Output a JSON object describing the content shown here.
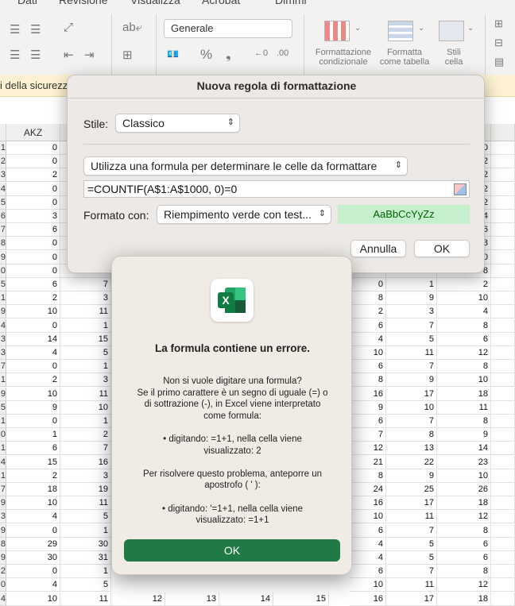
{
  "ribbon": {
    "menu_items": [
      "Dati",
      "Revisione",
      "Visualizza",
      "Acrobat",
      "Dimmi"
    ],
    "number_format": "Generale",
    "cond_format_label": [
      "Formattazione",
      "condizionale"
    ],
    "table_format_label": [
      "Formatta",
      "come tabella"
    ],
    "cell_styles_label": [
      "Stili",
      "cella"
    ]
  },
  "security_bar": {
    "text": "i della sicurezz"
  },
  "grid": {
    "column_header": "AKZ",
    "left_rows": [
      {
        "r": "1",
        "a": "0",
        "b": ""
      },
      {
        "r": "2",
        "a": "0",
        "b": ""
      },
      {
        "r": "3",
        "a": "2",
        "b": ""
      },
      {
        "r": "4",
        "a": "0",
        "b": ""
      },
      {
        "r": "5",
        "a": "0",
        "b": ""
      },
      {
        "r": "6",
        "a": "3",
        "b": ""
      },
      {
        "r": "7",
        "a": "6",
        "b": ""
      },
      {
        "r": "8",
        "a": "0",
        "b": ""
      },
      {
        "r": "9",
        "a": "0",
        "b": ""
      },
      {
        "r": "0",
        "a": "0",
        "b": ""
      },
      {
        "r": "5",
        "a": "6",
        "b": "7"
      },
      {
        "r": "1",
        "a": "2",
        "b": "3"
      },
      {
        "r": "9",
        "a": "10",
        "b": "11"
      },
      {
        "r": "4",
        "a": "0",
        "b": "1"
      },
      {
        "r": "3",
        "a": "14",
        "b": "15"
      },
      {
        "r": "3",
        "a": "4",
        "b": "5"
      },
      {
        "r": "7",
        "a": "0",
        "b": "1"
      },
      {
        "r": "1",
        "a": "2",
        "b": "3"
      },
      {
        "r": "9",
        "a": "10",
        "b": "11"
      },
      {
        "r": "5",
        "a": "9",
        "b": "10"
      },
      {
        "r": "1",
        "a": "0",
        "b": "1"
      },
      {
        "r": "0",
        "a": "1",
        "b": "2"
      },
      {
        "r": "1",
        "a": "6",
        "b": "7"
      },
      {
        "r": "4",
        "a": "15",
        "b": "16"
      },
      {
        "r": "1",
        "a": "2",
        "b": "3"
      },
      {
        "r": "7",
        "a": "18",
        "b": "19"
      },
      {
        "r": "9",
        "a": "10",
        "b": "11"
      },
      {
        "r": "3",
        "a": "4",
        "b": "5"
      },
      {
        "r": "9",
        "a": "0",
        "b": "1"
      },
      {
        "r": "8",
        "a": "29",
        "b": "30"
      },
      {
        "r": "9",
        "a": "30",
        "b": "31"
      },
      {
        "r": "2",
        "a": "0",
        "b": "1"
      },
      {
        "r": "0",
        "a": "4",
        "b": "5"
      },
      {
        "r": "4",
        "a": "10",
        "b": "11"
      }
    ],
    "right_rows": [
      {
        "a": "",
        "b": "",
        "c": "0"
      },
      {
        "a": "",
        "b": "",
        "c": "2"
      },
      {
        "a": "",
        "b": "",
        "c": "2"
      },
      {
        "a": "",
        "b": "",
        "c": "2"
      },
      {
        "a": "",
        "b": "",
        "c": "2"
      },
      {
        "a": "",
        "b": "",
        "c": "4"
      },
      {
        "a": "",
        "b": "",
        "c": "6"
      },
      {
        "a": "",
        "b": "",
        "c": "8"
      },
      {
        "a": "",
        "b": "",
        "c": "10"
      },
      {
        "a": "",
        "b": "",
        "c": "8"
      },
      {
        "a": "0",
        "b": "1",
        "c": "2"
      },
      {
        "a": "8",
        "b": "9",
        "c": "10"
      },
      {
        "a": "2",
        "b": "3",
        "c": "4"
      },
      {
        "a": "6",
        "b": "7",
        "c": "8"
      },
      {
        "a": "4",
        "b": "5",
        "c": "6"
      },
      {
        "a": "10",
        "b": "11",
        "c": "12"
      },
      {
        "a": "6",
        "b": "7",
        "c": "8"
      },
      {
        "a": "8",
        "b": "9",
        "c": "10"
      },
      {
        "a": "16",
        "b": "17",
        "c": "18"
      },
      {
        "a": "9",
        "b": "10",
        "c": "11"
      },
      {
        "a": "6",
        "b": "7",
        "c": "8"
      },
      {
        "a": "7",
        "b": "8",
        "c": "9"
      },
      {
        "a": "12",
        "b": "13",
        "c": "14"
      },
      {
        "a": "21",
        "b": "22",
        "c": "23"
      },
      {
        "a": "8",
        "b": "9",
        "c": "10"
      },
      {
        "a": "24",
        "b": "25",
        "c": "26"
      },
      {
        "a": "16",
        "b": "17",
        "c": "18"
      },
      {
        "a": "10",
        "b": "11",
        "c": "12"
      },
      {
        "a": "6",
        "b": "7",
        "c": "8"
      },
      {
        "a": "4",
        "b": "5",
        "c": "6"
      },
      {
        "a": "4",
        "b": "5",
        "c": "6"
      },
      {
        "a": "6",
        "b": "7",
        "c": "8"
      },
      {
        "a": "10",
        "b": "11",
        "c": "12"
      },
      {
        "a": "16",
        "b": "17",
        "c": "18"
      }
    ],
    "bottom_row": [
      "12",
      "13",
      "14",
      "15"
    ]
  },
  "rule_dialog": {
    "title": "Nuova regola di formattazione",
    "style_label": "Stile:",
    "style_value": "Classico",
    "rule_type": "Utilizza una formula per determinare le celle da formattare",
    "formula": "=COUNTIF(A$1:A$1000, 0)=0",
    "format_label": "Formato con:",
    "format_value": "Riempimento verde con test...",
    "preview_text": "AaBbCcYyZz",
    "preview_color": "#c6efce",
    "preview_text_color": "#006100",
    "cancel_label": "Annulla",
    "ok_label": "OK"
  },
  "error_dialog": {
    "app_icon": "excel-icon",
    "title": "La formula contiene un errore.",
    "lines": [
      "Non si vuole digitare una formula?",
      "Se il primo carattere è un segno di uguale (=) o",
      "di sottrazione (-), in Excel viene interpretato",
      "come formula:",
      "",
      "• digitando: =1+1, nella cella viene",
      "visualizzato: 2",
      "",
      "Per risolvere questo problema, anteporre un",
      "apostrofo ( ' ):",
      "",
      "• digitando: '=1+1, nella cella viene",
      "visualizzato: =1+1"
    ],
    "ok_label": "OK",
    "ok_color": "#1f7a45"
  }
}
